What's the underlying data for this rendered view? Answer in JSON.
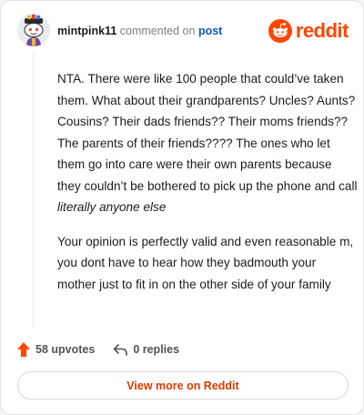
{
  "comment": {
    "username": "mintpink11",
    "action_text": "commented on",
    "post_link_label": "post",
    "paragraphs": [
      {
        "text": "NTA. There were like 100 people that could’ve taken them. What about their grandparents? Uncles? Aunts? Cousins? Their dads friends?? Their moms friends?? The parents of their friends???? The ones who let them go into care were their own parents because they couldn’t be bothered to pick up the phone and call ",
        "emphasis": "literally anyone else"
      },
      {
        "text": "Your opinion is perfectly valid and even reasonable m, you dont have to hear how they badmouth your mother just to fit in on the other side of your family"
      }
    ]
  },
  "brand": {
    "wordmark": "reddit",
    "color": "#ff4500"
  },
  "stats": {
    "upvotes_label": "58 upvotes",
    "replies_label": "0 replies"
  },
  "cta": {
    "label": "View more on Reddit"
  },
  "colors": {
    "accent": "#ff4500",
    "link": "#0a56c7",
    "cta_text": "#d93a00"
  }
}
